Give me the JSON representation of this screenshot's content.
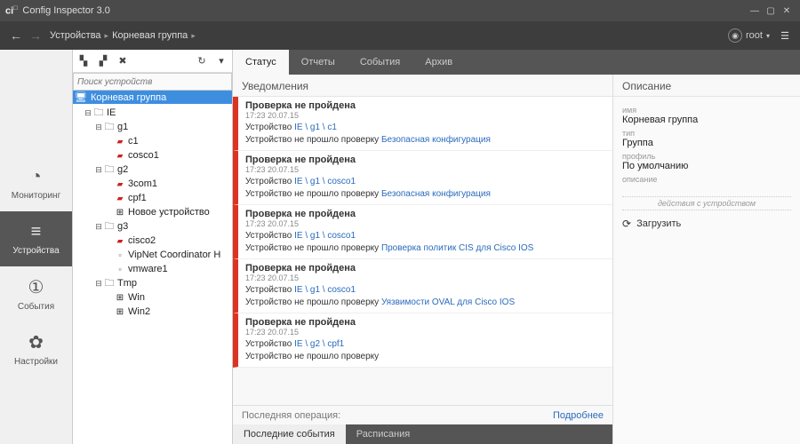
{
  "window": {
    "title": "Config Inspector 3.0"
  },
  "breadcrumb": {
    "items": [
      "Устройства",
      "Корневая группа"
    ]
  },
  "user": {
    "name": "root"
  },
  "rail": {
    "items": [
      {
        "icon": "◔",
        "label": "Мониторинг"
      },
      {
        "icon": "≡",
        "label": "Устройства",
        "active": true
      },
      {
        "icon": "①",
        "label": "События"
      },
      {
        "icon": "✿",
        "label": "Настройки"
      }
    ]
  },
  "tree": {
    "search_placeholder": "Поиск устройств",
    "root_label": "Корневая группа",
    "nodes": [
      {
        "depth": 1,
        "tw": "⊟",
        "icon": "folder",
        "label": "IE"
      },
      {
        "depth": 2,
        "tw": "⊟",
        "icon": "folder",
        "label": "g1"
      },
      {
        "depth": 3,
        "tw": "",
        "icon": "dev-eth",
        "label": "c1"
      },
      {
        "depth": 3,
        "tw": "",
        "icon": "dev-eth",
        "label": "cosco1"
      },
      {
        "depth": 2,
        "tw": "⊟",
        "icon": "folder",
        "label": "g2"
      },
      {
        "depth": 3,
        "tw": "",
        "icon": "dev-eth",
        "label": "3com1"
      },
      {
        "depth": 3,
        "tw": "",
        "icon": "dev-eth",
        "label": "cpf1"
      },
      {
        "depth": 3,
        "tw": "",
        "icon": "dev-win",
        "label": "Новое устройство"
      },
      {
        "depth": 2,
        "tw": "⊟",
        "icon": "folder",
        "label": "g3"
      },
      {
        "depth": 3,
        "tw": "",
        "icon": "dev-eth",
        "label": "cisco2"
      },
      {
        "depth": 3,
        "tw": "",
        "icon": "dev-plain",
        "label": "VipNet Coordinator H"
      },
      {
        "depth": 3,
        "tw": "",
        "icon": "dev-plain",
        "label": "vmware1"
      },
      {
        "depth": 2,
        "tw": "⊟",
        "icon": "folder",
        "label": "Tmp"
      },
      {
        "depth": 3,
        "tw": "",
        "icon": "dev-win",
        "label": "Win"
      },
      {
        "depth": 3,
        "tw": "",
        "icon": "dev-win",
        "label": "Win2"
      }
    ]
  },
  "tabs": {
    "items": [
      {
        "label": "Статус",
        "active": true
      },
      {
        "label": "Отчеты"
      },
      {
        "label": "События"
      },
      {
        "label": "Архив"
      }
    ]
  },
  "notifications": {
    "header": "Уведомления",
    "items": [
      {
        "title": "Проверка не пройдена",
        "time": "17:23 20.07.15",
        "device_prefix": "Устройство ",
        "device_path": "IE \\ g1 \\ c1",
        "line2_prefix": "Устройство не прошло проверку ",
        "line2_link": "Безопасная конфигурация"
      },
      {
        "title": "Проверка не пройдена",
        "time": "17:23 20.07.15",
        "device_prefix": "Устройство ",
        "device_path": "IE \\ g1 \\ cosco1",
        "line2_prefix": "Устройство не прошло проверку ",
        "line2_link": "Безопасная конфигурация"
      },
      {
        "title": "Проверка не пройдена",
        "time": "17:23 20.07.15",
        "device_prefix": "Устройство ",
        "device_path": "IE \\ g1 \\ cosco1",
        "line2_prefix": "Устройство не прошло проверку ",
        "line2_link": "Проверка политик CIS для Cisco IOS"
      },
      {
        "title": "Проверка не пройдена",
        "time": "17:23 20.07.15",
        "device_prefix": "Устройство ",
        "device_path": "IE \\ g1 \\ cosco1",
        "line2_prefix": "Устройство не прошло проверку ",
        "line2_link": "Уязвимости OVAL для Cisco IOS"
      },
      {
        "title": "Проверка не пройдена",
        "time": "17:23 20.07.15",
        "device_prefix": "Устройство ",
        "device_path": "IE \\ g2 \\ cpf1",
        "line2_prefix": "Устройство не прошло проверку",
        "line2_link": ""
      }
    ],
    "footer_label": "Последняя операция:",
    "footer_more": "Подробнее"
  },
  "description": {
    "header": "Описание",
    "fields": [
      {
        "label": "имя",
        "value": "Корневая группа"
      },
      {
        "label": "тип",
        "value": "Группа"
      },
      {
        "label": "профиль",
        "value": "По умолчанию"
      },
      {
        "label": "описание",
        "value": ""
      }
    ],
    "actions_header": "действия с устройством",
    "actions": [
      {
        "icon": "⟳",
        "label": "Загрузить"
      }
    ]
  },
  "bottom_tabs": {
    "items": [
      {
        "label": "Последние события",
        "active": true
      },
      {
        "label": "Расписания"
      }
    ]
  }
}
